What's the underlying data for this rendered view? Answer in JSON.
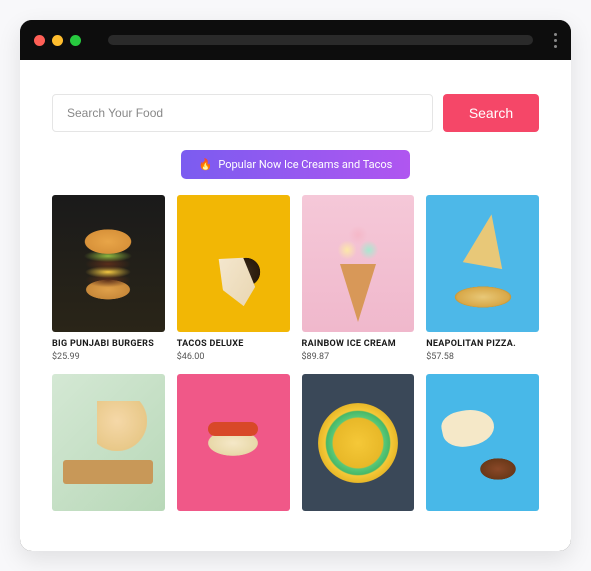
{
  "search": {
    "placeholder": "Search Your Food",
    "button": "Search"
  },
  "banner": {
    "emoji": "🔥",
    "text": "Popular Now Ice Creams and Tacos"
  },
  "colors": {
    "accent": "#f54768",
    "banner_gradient_from": "#7b5cf0",
    "banner_gradient_to": "#b056f0"
  },
  "products": [
    {
      "title": "BIG PUNJABI BURGERS",
      "price": "$25.99",
      "thumb": "burger"
    },
    {
      "title": "TACOS DELUXE",
      "price": "$46.00",
      "thumb": "taco"
    },
    {
      "title": "RAINBOW ICE CREAM",
      "price": "$89.87",
      "thumb": "icecream"
    },
    {
      "title": "NEAPOLITAN PIZZA.",
      "price": "$57.58",
      "thumb": "pizza"
    },
    {
      "title": "",
      "price": "",
      "thumb": "food5"
    },
    {
      "title": "",
      "price": "",
      "thumb": "food6"
    },
    {
      "title": "",
      "price": "",
      "thumb": "food7"
    },
    {
      "title": "",
      "price": "",
      "thumb": "food8"
    }
  ]
}
